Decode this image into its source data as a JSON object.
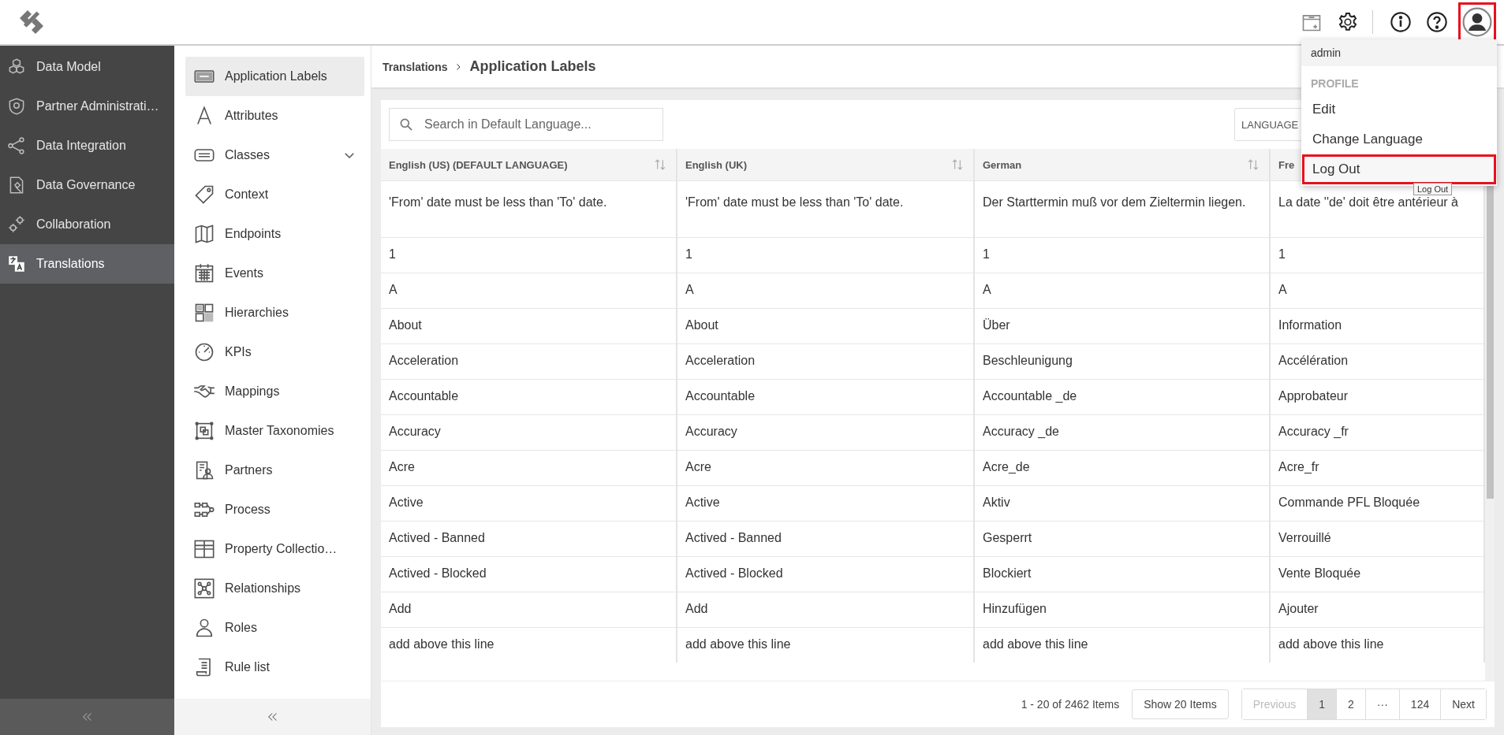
{
  "nav": {
    "items": [
      {
        "label": "Data Model",
        "selected": false
      },
      {
        "label": "Partner Administrati…",
        "selected": false
      },
      {
        "label": "Data Integration",
        "selected": false
      },
      {
        "label": "Data Governance",
        "selected": false
      },
      {
        "label": "Collaboration",
        "selected": false
      },
      {
        "label": "Translations",
        "selected": true
      }
    ]
  },
  "subnav": {
    "items": [
      {
        "label": "Application Labels",
        "selected": true,
        "expandable": false
      },
      {
        "label": "Attributes",
        "selected": false,
        "expandable": false
      },
      {
        "label": "Classes",
        "selected": false,
        "expandable": true
      },
      {
        "label": "Context",
        "selected": false,
        "expandable": false
      },
      {
        "label": "Endpoints",
        "selected": false,
        "expandable": false
      },
      {
        "label": "Events",
        "selected": false,
        "expandable": false
      },
      {
        "label": "Hierarchies",
        "selected": false,
        "expandable": false
      },
      {
        "label": "KPIs",
        "selected": false,
        "expandable": false
      },
      {
        "label": "Mappings",
        "selected": false,
        "expandable": false
      },
      {
        "label": "Master Taxonomies",
        "selected": false,
        "expandable": false
      },
      {
        "label": "Partners",
        "selected": false,
        "expandable": false
      },
      {
        "label": "Process",
        "selected": false,
        "expandable": false
      },
      {
        "label": "Property Collectio…",
        "selected": false,
        "expandable": false
      },
      {
        "label": "Relationships",
        "selected": false,
        "expandable": false
      },
      {
        "label": "Roles",
        "selected": false,
        "expandable": false
      },
      {
        "label": "Rule list",
        "selected": false,
        "expandable": false
      }
    ]
  },
  "breadcrumb": [
    "Translations",
    "Application Labels"
  ],
  "search": {
    "placeholder": "Search in Default Language..."
  },
  "language_filter": {
    "label": "LANGUAGE"
  },
  "table": {
    "columns": [
      {
        "label": "English (US) (DEFAULT LANGUAGE)"
      },
      {
        "label": "English (UK)"
      },
      {
        "label": "German"
      },
      {
        "label": "Fre"
      }
    ],
    "rows": [
      [
        "'From' date must be less than 'To' date.",
        "'From' date must be less than 'To' date.",
        "Der Starttermin muß vor dem Zieltermin liegen.",
        "La date ''de' doit être antérieur à"
      ],
      [
        "1",
        "1",
        "1",
        "1"
      ],
      [
        "A",
        "A",
        "A",
        "A"
      ],
      [
        "About",
        "About",
        "Über",
        "Information"
      ],
      [
        "Acceleration",
        "Acceleration",
        "Beschleunigung",
        "Accélération"
      ],
      [
        "Accountable",
        "Accountable",
        "Accountable _de",
        "Approbateur"
      ],
      [
        "Accuracy",
        "Accuracy",
        "Accuracy _de",
        "Accuracy _fr"
      ],
      [
        "Acre",
        "Acre",
        "Acre_de",
        "Acre_fr"
      ],
      [
        "Active",
        "Active",
        "Aktiv",
        "Commande PFL Bloquée"
      ],
      [
        "Actived - Banned",
        "Actived - Banned",
        "Gesperrt",
        "Verrouillé"
      ],
      [
        "Actived - Blocked",
        "Actived - Blocked",
        "Blockiert",
        "Vente Bloquée"
      ],
      [
        "Add",
        "Add",
        "Hinzufügen",
        "Ajouter"
      ],
      [
        "add above this line",
        "add above this line",
        "add above this line",
        "add above this line"
      ]
    ]
  },
  "footer": {
    "summary": "1 - 20 of 2462 Items",
    "page_size": "Show 20 Items",
    "pages": [
      {
        "label": "Previous",
        "selected": false,
        "disabled": true
      },
      {
        "label": "1",
        "selected": true,
        "disabled": false
      },
      {
        "label": "2",
        "selected": false,
        "disabled": false
      },
      {
        "label": "···",
        "selected": false,
        "disabled": false
      },
      {
        "label": "124",
        "selected": false,
        "disabled": false
      },
      {
        "label": "Next",
        "selected": false,
        "disabled": false
      }
    ]
  },
  "user_menu": {
    "avatar_highlighted": true,
    "items": [
      {
        "kind": "user",
        "label": "admin"
      },
      {
        "kind": "header",
        "label": "PROFILE"
      },
      {
        "kind": "action",
        "label": "Edit",
        "highlighted": false
      },
      {
        "kind": "action",
        "label": "Change Language",
        "highlighted": false
      },
      {
        "kind": "action",
        "label": "Log Out",
        "highlighted": true
      }
    ],
    "tooltip": "Log Out"
  }
}
